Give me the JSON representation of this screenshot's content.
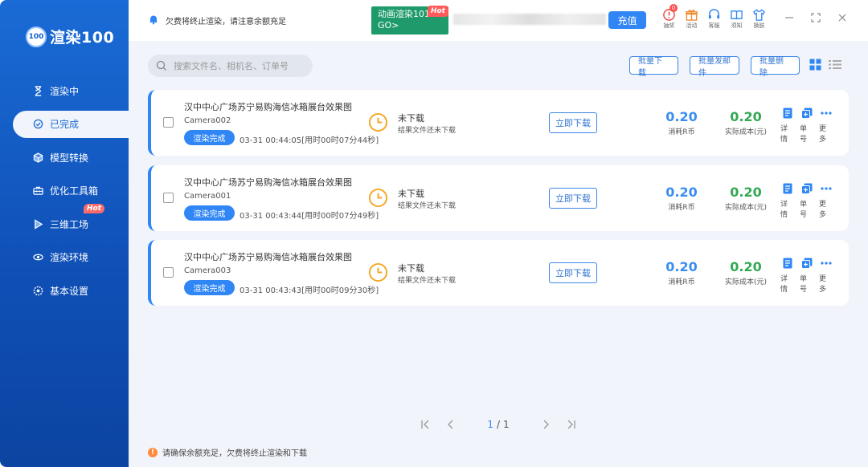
{
  "app": {
    "logo_badge": "100",
    "logo_text": "渲染100"
  },
  "sidebar": {
    "items": [
      {
        "label": "渲染中",
        "icon": "hourglass-icon"
      },
      {
        "label": "已完成",
        "icon": "completed-icon"
      },
      {
        "label": "模型转换",
        "icon": "cube-icon"
      },
      {
        "label": "优化工具箱",
        "icon": "toolbox-icon"
      },
      {
        "label": "三维工场",
        "icon": "play-box-icon",
        "hot": "Hot"
      },
      {
        "label": "渲染环境",
        "icon": "environment-icon"
      },
      {
        "label": "基本设置",
        "icon": "settings-icon"
      }
    ]
  },
  "topbar": {
    "notice": "欠费将终止渲染，请注意余额充足",
    "promo_line1": "动画渲染101",
    "promo_line2": "GO>",
    "promo_hot": "Hot",
    "recharge": "充值",
    "badge_count": "0",
    "icons": [
      {
        "label": "抽奖",
        "icon": "lottery-icon"
      },
      {
        "label": "活动",
        "icon": "gift-icon"
      },
      {
        "label": "客服",
        "icon": "headset-icon"
      },
      {
        "label": "须知",
        "icon": "book-icon"
      },
      {
        "label": "换肤",
        "icon": "shirt-icon"
      }
    ]
  },
  "toolbar": {
    "search_placeholder": "搜索文件名、相机名、订单号",
    "batch_download": "批量下载",
    "batch_send": "批量发邮件",
    "batch_delete": "批量删除"
  },
  "tasks": [
    {
      "title": "汉中中心广场苏宁易购海信冰箱展台效果图",
      "camera": "Camera002",
      "status": "渲染完成",
      "time": "03-31 00:44:05[用时00时07分44秒]",
      "dl_state": "未下载",
      "dl_sub": "结果文件还未下载",
      "dl_btn": "立即下载",
      "rcoin": "0.20",
      "rcoin_label": "消耗R币",
      "cost": "0.20",
      "cost_label": "实际成本(元)",
      "ops": [
        "详情",
        "单号",
        "更多"
      ]
    },
    {
      "title": "汉中中心广场苏宁易购海信冰箱展台效果图",
      "camera": "Camera001",
      "status": "渲染完成",
      "time": "03-31 00:43:44[用时00时07分49秒]",
      "dl_state": "未下载",
      "dl_sub": "结果文件还未下载",
      "dl_btn": "立即下载",
      "rcoin": "0.20",
      "rcoin_label": "消耗R币",
      "cost": "0.20",
      "cost_label": "实际成本(元)",
      "ops": [
        "详情",
        "单号",
        "更多"
      ]
    },
    {
      "title": "汉中中心广场苏宁易购海信冰箱展台效果图",
      "camera": "Camera003",
      "status": "渲染完成",
      "time": "03-31 00:43:43[用时00时09分30秒]",
      "dl_state": "未下载",
      "dl_sub": "结果文件还未下载",
      "dl_btn": "立即下载",
      "rcoin": "0.20",
      "rcoin_label": "消耗R币",
      "cost": "0.20",
      "cost_label": "实际成本(元)",
      "ops": [
        "详情",
        "单号",
        "更多"
      ]
    }
  ],
  "pager": {
    "current": "1",
    "sep": "/",
    "total": "1"
  },
  "footer": {
    "notice": "请确保余额充足，欠费将终止渲染和下载",
    "warn_glyph": "!"
  },
  "colors": {
    "accent": "#2f86f4",
    "sidebar": "#1561c9",
    "cost_green": "#34a853",
    "promo_green": "#1e9a6b"
  }
}
